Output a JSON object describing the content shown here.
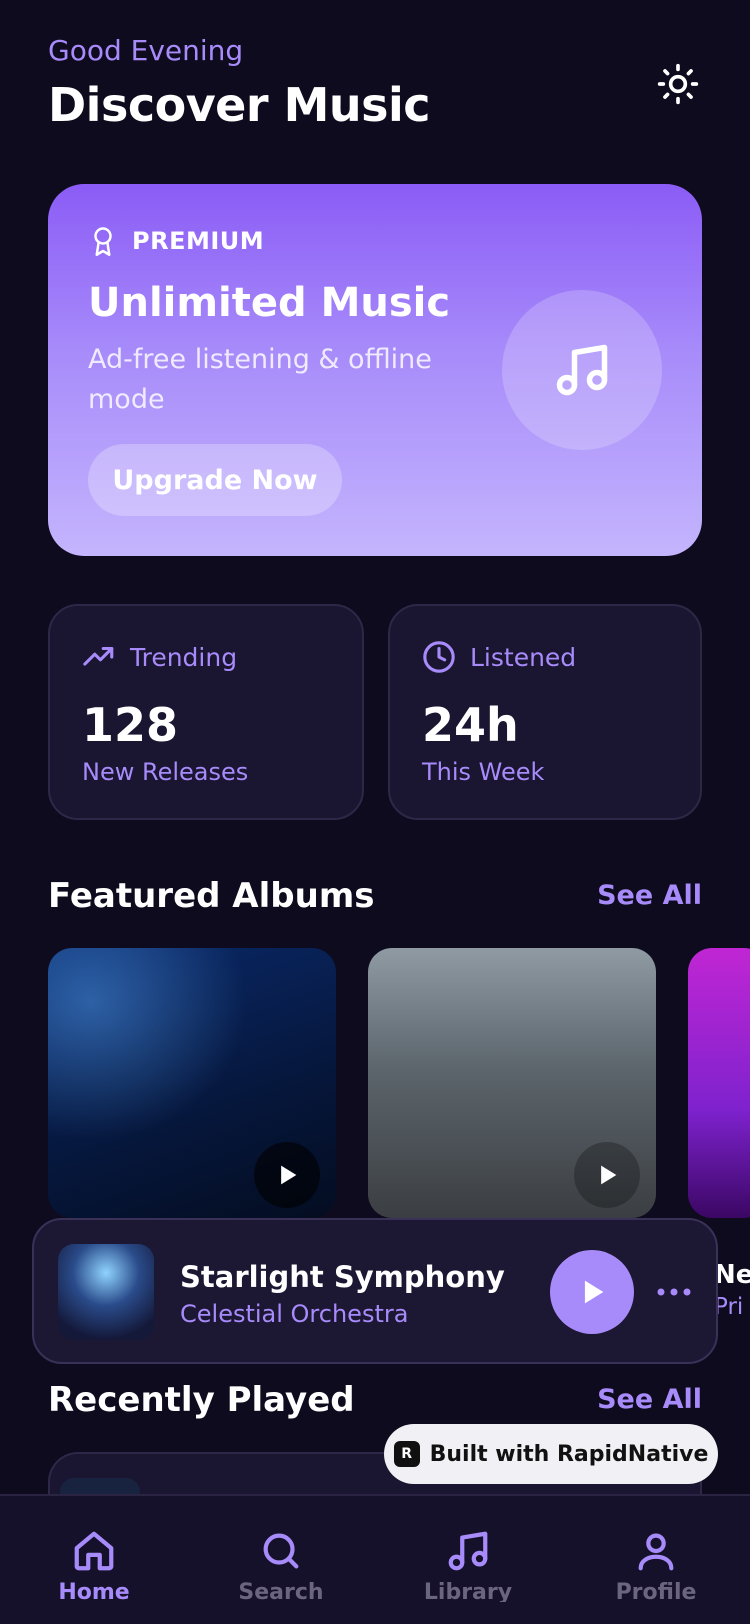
{
  "header": {
    "greeting": "Good Evening",
    "title": "Discover Music",
    "theme_icon": "sun-icon"
  },
  "premium": {
    "badge": "PREMIUM",
    "title": "Unlimited Music",
    "subtitle": "Ad-free listening & offline mode",
    "cta": "Upgrade Now"
  },
  "stats": [
    {
      "icon": "trending-up-icon",
      "label": "Trending",
      "value": "128",
      "sub": "New Releases"
    },
    {
      "icon": "clock-icon",
      "label": "Listened",
      "value": "24h",
      "sub": "This Week"
    }
  ],
  "featured": {
    "heading": "Featured Albums",
    "see_all": "See All"
  },
  "now_playing": {
    "title": "Starlight Symphony",
    "artist": "Celestial Orchestra",
    "peek_title": "Neo",
    "peek_artist": "Pri"
  },
  "recent": {
    "heading": "Recently Played",
    "see_all": "See All"
  },
  "badge": {
    "text": "Built with RapidNative"
  },
  "tabs": [
    {
      "label": "Home",
      "icon": "home-icon",
      "active": true
    },
    {
      "label": "Search",
      "icon": "search-icon",
      "active": false
    },
    {
      "label": "Library",
      "icon": "music-note-icon",
      "active": false
    },
    {
      "label": "Profile",
      "icon": "user-icon",
      "active": false
    }
  ],
  "colors": {
    "background": "#0f0b1e",
    "accent": "#a78bfa",
    "card": "#1a1530"
  }
}
